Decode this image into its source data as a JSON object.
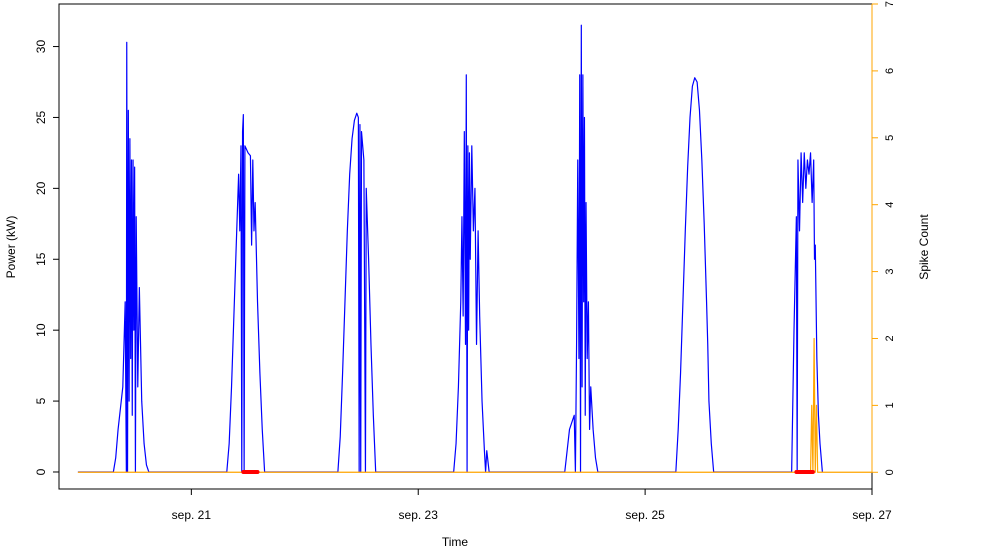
{
  "chart_data": {
    "type": "line",
    "title": "",
    "xlabel": "Time",
    "ylabel_left": "Power (kW)",
    "ylabel_right": "Spike Count",
    "xlim": [
      "2020-09-19T20:00",
      "2020-09-27T00:00"
    ],
    "ylim_left": [
      -1.2,
      33.0
    ],
    "ylim_right": [
      -0.25,
      7.0
    ],
    "x_ticks": [
      {
        "date": "2020-09-21",
        "label": "sep. 21"
      },
      {
        "date": "2020-09-23",
        "label": "sep. 23"
      },
      {
        "date": "2020-09-25",
        "label": "sep. 25"
      },
      {
        "date": "2020-09-27",
        "label": "sep. 27"
      }
    ],
    "y_ticks_left": [
      0,
      5,
      10,
      15,
      20,
      25,
      30
    ],
    "y_ticks_right": [
      0,
      1,
      2,
      3,
      4,
      5,
      6,
      7
    ],
    "grid": false,
    "legend": "none",
    "colors": {
      "power": "#0000ff",
      "spike_count": "#ffa500",
      "spike_marker": "#ff0000",
      "axis": "#000000"
    },
    "series": [
      {
        "axis": "left",
        "color": "#0000ff",
        "points": [
          [
            "2020-09-20T00:00",
            0
          ],
          [
            "2020-09-20T07:30",
            0
          ],
          [
            "2020-09-20T08:00",
            1.0
          ],
          [
            "2020-09-20T08:30",
            3.0
          ],
          [
            "2020-09-20T09:00",
            4.5
          ],
          [
            "2020-09-20T09:30",
            6.0
          ],
          [
            "2020-09-20T10:00",
            12.0
          ],
          [
            "2020-09-20T10:15",
            0
          ],
          [
            "2020-09-20T10:20",
            30.3
          ],
          [
            "2020-09-20T10:30",
            0
          ],
          [
            "2020-09-20T10:40",
            25.5
          ],
          [
            "2020-09-20T10:50",
            5.0
          ],
          [
            "2020-09-20T11:00",
            23.5
          ],
          [
            "2020-09-20T11:10",
            8.0
          ],
          [
            "2020-09-20T11:20",
            22.0
          ],
          [
            "2020-09-20T11:30",
            4.0
          ],
          [
            "2020-09-20T11:40",
            22.0
          ],
          [
            "2020-09-20T11:50",
            10.0
          ],
          [
            "2020-09-20T12:00",
            21.5
          ],
          [
            "2020-09-20T12:10",
            0
          ],
          [
            "2020-09-20T12:20",
            18.0
          ],
          [
            "2020-09-20T12:40",
            6.0
          ],
          [
            "2020-09-20T13:00",
            13.0
          ],
          [
            "2020-09-20T13:30",
            5.0
          ],
          [
            "2020-09-20T14:00",
            2.0
          ],
          [
            "2020-09-20T14:30",
            0.5
          ],
          [
            "2020-09-20T15:00",
            0
          ],
          [
            "2020-09-21T07:30",
            0
          ],
          [
            "2020-09-21T08:00",
            2.0
          ],
          [
            "2020-09-21T08:30",
            6.0
          ],
          [
            "2020-09-21T09:00",
            11.0
          ],
          [
            "2020-09-21T09:30",
            16.0
          ],
          [
            "2020-09-21T10:00",
            21.0
          ],
          [
            "2020-09-21T10:15",
            17.0
          ],
          [
            "2020-09-21T10:30",
            23.0
          ],
          [
            "2020-09-21T10:40",
            0
          ],
          [
            "2020-09-21T10:50",
            24.0
          ],
          [
            "2020-09-21T11:00",
            25.2
          ],
          [
            "2020-09-21T11:10",
            0
          ],
          [
            "2020-09-21T11:20",
            23.0
          ],
          [
            "2020-09-21T12:00",
            22.5
          ],
          [
            "2020-09-21T12:30",
            22.3
          ],
          [
            "2020-09-21T12:45",
            16.0
          ],
          [
            "2020-09-21T13:00",
            22.0
          ],
          [
            "2020-09-21T13:15",
            17.0
          ],
          [
            "2020-09-21T13:30",
            19.0
          ],
          [
            "2020-09-21T14:00",
            12.0
          ],
          [
            "2020-09-21T14:30",
            7.0
          ],
          [
            "2020-09-21T15:00",
            3.0
          ],
          [
            "2020-09-21T15:30",
            0
          ],
          [
            "2020-09-22T07:00",
            0
          ],
          [
            "2020-09-22T07:30",
            2.5
          ],
          [
            "2020-09-22T08:00",
            7.0
          ],
          [
            "2020-09-22T08:30",
            12.0
          ],
          [
            "2020-09-22T09:00",
            17.0
          ],
          [
            "2020-09-22T09:30",
            21.0
          ],
          [
            "2020-09-22T10:00",
            23.5
          ],
          [
            "2020-09-22T10:30",
            24.8
          ],
          [
            "2020-09-22T11:00",
            25.3
          ],
          [
            "2020-09-22T11:20",
            25.0
          ],
          [
            "2020-09-22T11:30",
            0
          ],
          [
            "2020-09-22T11:40",
            24.5
          ],
          [
            "2020-09-22T11:50",
            0
          ],
          [
            "2020-09-22T12:00",
            24.0
          ],
          [
            "2020-09-22T12:30",
            22.0
          ],
          [
            "2020-09-22T12:50",
            0
          ],
          [
            "2020-09-22T13:00",
            20.0
          ],
          [
            "2020-09-22T13:30",
            15.0
          ],
          [
            "2020-09-22T14:00",
            9.0
          ],
          [
            "2020-09-22T14:30",
            4.0
          ],
          [
            "2020-09-22T15:00",
            0
          ],
          [
            "2020-09-23T07:30",
            0
          ],
          [
            "2020-09-23T08:00",
            2.0
          ],
          [
            "2020-09-23T08:30",
            6.0
          ],
          [
            "2020-09-23T09:00",
            12.0
          ],
          [
            "2020-09-23T09:15",
            18.0
          ],
          [
            "2020-09-23T09:30",
            11.0
          ],
          [
            "2020-09-23T09:45",
            24.0
          ],
          [
            "2020-09-23T10:00",
            9.0
          ],
          [
            "2020-09-23T10:10",
            28.0
          ],
          [
            "2020-09-23T10:20",
            0
          ],
          [
            "2020-09-23T10:30",
            23.0
          ],
          [
            "2020-09-23T10:40",
            10.0
          ],
          [
            "2020-09-23T10:50",
            22.5
          ],
          [
            "2020-09-23T11:00",
            15.0
          ],
          [
            "2020-09-23T11:20",
            23.0
          ],
          [
            "2020-09-23T11:40",
            17.0
          ],
          [
            "2020-09-23T12:00",
            20.0
          ],
          [
            "2020-09-23T12:20",
            9.0
          ],
          [
            "2020-09-23T12:40",
            17.0
          ],
          [
            "2020-09-23T13:00",
            11.0
          ],
          [
            "2020-09-23T13:30",
            5.0
          ],
          [
            "2020-09-23T14:00",
            1.5
          ],
          [
            "2020-09-23T14:15",
            0
          ],
          [
            "2020-09-23T14:30",
            1.5
          ],
          [
            "2020-09-23T15:00",
            0
          ],
          [
            "2020-09-24T07:00",
            0
          ],
          [
            "2020-09-24T07:30",
            1.5
          ],
          [
            "2020-09-24T08:00",
            3.0
          ],
          [
            "2020-09-24T08:30",
            3.5
          ],
          [
            "2020-09-24T09:00",
            4.0
          ],
          [
            "2020-09-24T09:15",
            0
          ],
          [
            "2020-09-24T09:30",
            9.0
          ],
          [
            "2020-09-24T09:45",
            22.0
          ],
          [
            "2020-09-24T10:00",
            8.0
          ],
          [
            "2020-09-24T10:10",
            28.0
          ],
          [
            "2020-09-24T10:20",
            0
          ],
          [
            "2020-09-24T10:30",
            31.5
          ],
          [
            "2020-09-24T10:40",
            6.0
          ],
          [
            "2020-09-24T10:50",
            28.0
          ],
          [
            "2020-09-24T11:00",
            12.0
          ],
          [
            "2020-09-24T11:10",
            25.0
          ],
          [
            "2020-09-24T11:20",
            4.0
          ],
          [
            "2020-09-24T11:30",
            19.0
          ],
          [
            "2020-09-24T11:45",
            8.0
          ],
          [
            "2020-09-24T12:00",
            12.0
          ],
          [
            "2020-09-24T12:15",
            3.0
          ],
          [
            "2020-09-24T12:30",
            6.0
          ],
          [
            "2020-09-24T13:00",
            3.0
          ],
          [
            "2020-09-24T13:30",
            1.0
          ],
          [
            "2020-09-24T14:00",
            0
          ],
          [
            "2020-09-25T06:30",
            0
          ],
          [
            "2020-09-25T07:00",
            3.0
          ],
          [
            "2020-09-25T07:30",
            7.0
          ],
          [
            "2020-09-25T08:00",
            12.0
          ],
          [
            "2020-09-25T08:30",
            17.0
          ],
          [
            "2020-09-25T09:00",
            21.5
          ],
          [
            "2020-09-25T09:30",
            25.0
          ],
          [
            "2020-09-25T10:00",
            27.2
          ],
          [
            "2020-09-25T10:30",
            27.8
          ],
          [
            "2020-09-25T11:00",
            27.5
          ],
          [
            "2020-09-25T11:30",
            25.5
          ],
          [
            "2020-09-25T12:00",
            22.0
          ],
          [
            "2020-09-25T12:30",
            17.5
          ],
          [
            "2020-09-25T13:00",
            12.0
          ],
          [
            "2020-09-25T13:15",
            9.0
          ],
          [
            "2020-09-25T13:30",
            5.0
          ],
          [
            "2020-09-25T14:00",
            2.0
          ],
          [
            "2020-09-25T14:30",
            0
          ],
          [
            "2020-09-26T07:00",
            0
          ],
          [
            "2020-09-26T07:30",
            10.0
          ],
          [
            "2020-09-26T08:00",
            18.0
          ],
          [
            "2020-09-26T08:10",
            0
          ],
          [
            "2020-09-26T08:20",
            22.0
          ],
          [
            "2020-09-26T08:40",
            17.0
          ],
          [
            "2020-09-26T09:00",
            22.5
          ],
          [
            "2020-09-26T09:20",
            19.0
          ],
          [
            "2020-09-26T09:40",
            22.5
          ],
          [
            "2020-09-26T10:00",
            20.0
          ],
          [
            "2020-09-26T10:20",
            22.0
          ],
          [
            "2020-09-26T10:40",
            21.0
          ],
          [
            "2020-09-26T11:00",
            22.5
          ],
          [
            "2020-09-26T11:20",
            19.0
          ],
          [
            "2020-09-26T11:40",
            22.0
          ],
          [
            "2020-09-26T11:50",
            15.0
          ],
          [
            "2020-09-26T12:00",
            16.0
          ],
          [
            "2020-09-26T12:20",
            8.0
          ],
          [
            "2020-09-26T12:40",
            4.0
          ],
          [
            "2020-09-26T13:00",
            2.0
          ],
          [
            "2020-09-26T13:30",
            0
          ]
        ]
      },
      {
        "axis": "right",
        "color": "#ffa500",
        "points": [
          [
            "2020-09-20T00:00",
            0
          ],
          [
            "2020-09-26T11:00",
            0
          ],
          [
            "2020-09-26T11:15",
            1.0
          ],
          [
            "2020-09-26T11:30",
            0
          ],
          [
            "2020-09-26T11:45",
            2.0
          ],
          [
            "2020-09-26T12:00",
            0
          ],
          [
            "2020-09-26T12:15",
            1.0
          ],
          [
            "2020-09-26T12:30",
            0
          ],
          [
            "2020-09-27T00:00",
            0
          ]
        ]
      }
    ],
    "spike_markers": [
      {
        "start": "2020-09-21T11:00",
        "end": "2020-09-21T14:00",
        "value": 0
      },
      {
        "start": "2020-09-26T08:00",
        "end": "2020-09-26T11:30",
        "value": 0
      }
    ]
  }
}
